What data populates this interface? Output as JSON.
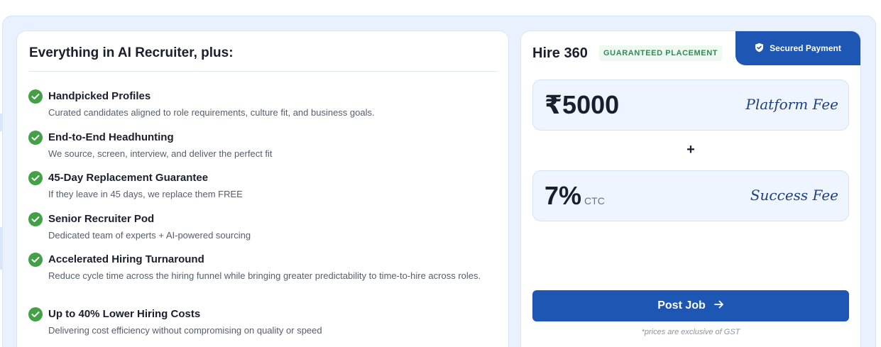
{
  "features": {
    "title": "Everything in AI Recruiter, plus:",
    "items": [
      {
        "title": "Handpicked Profiles",
        "desc": "Curated candidates aligned to role requirements, culture fit, and business goals."
      },
      {
        "title": "End-to-End Headhunting",
        "desc": "We source, screen, interview, and deliver the perfect fit"
      },
      {
        "title": "45-Day Replacement Guarantee",
        "desc": "If they leave in 45 days, we replace them FREE"
      },
      {
        "title": "Senior Recruiter Pod",
        "desc": "Dedicated team of experts + AI-powered sourcing"
      },
      {
        "title": "Accelerated Hiring Turnaround",
        "desc": "Reduce cycle time across the hiring funnel while bringing greater predictability to time-to-hire across roles."
      },
      {
        "title": "Up to 40% Lower Hiring Costs",
        "desc": "Delivering cost efficiency without compromising on quality or speed"
      }
    ]
  },
  "pricing": {
    "plan_name": "Hire 360",
    "badge": "GUARANTEED PLACEMENT",
    "secure_label": "Secured Payment",
    "platform_fee": {
      "amount": "₹5000",
      "label": "Platform Fee"
    },
    "plus": "+",
    "success_fee": {
      "amount": "7%",
      "unit": "CTC",
      "label": "Success Fee"
    },
    "cta": "Post Job",
    "note": "*prices are exclusive of GST"
  },
  "colors": {
    "accent": "#1e56b4",
    "check": "#43a047",
    "background": "#e8f1fd"
  }
}
